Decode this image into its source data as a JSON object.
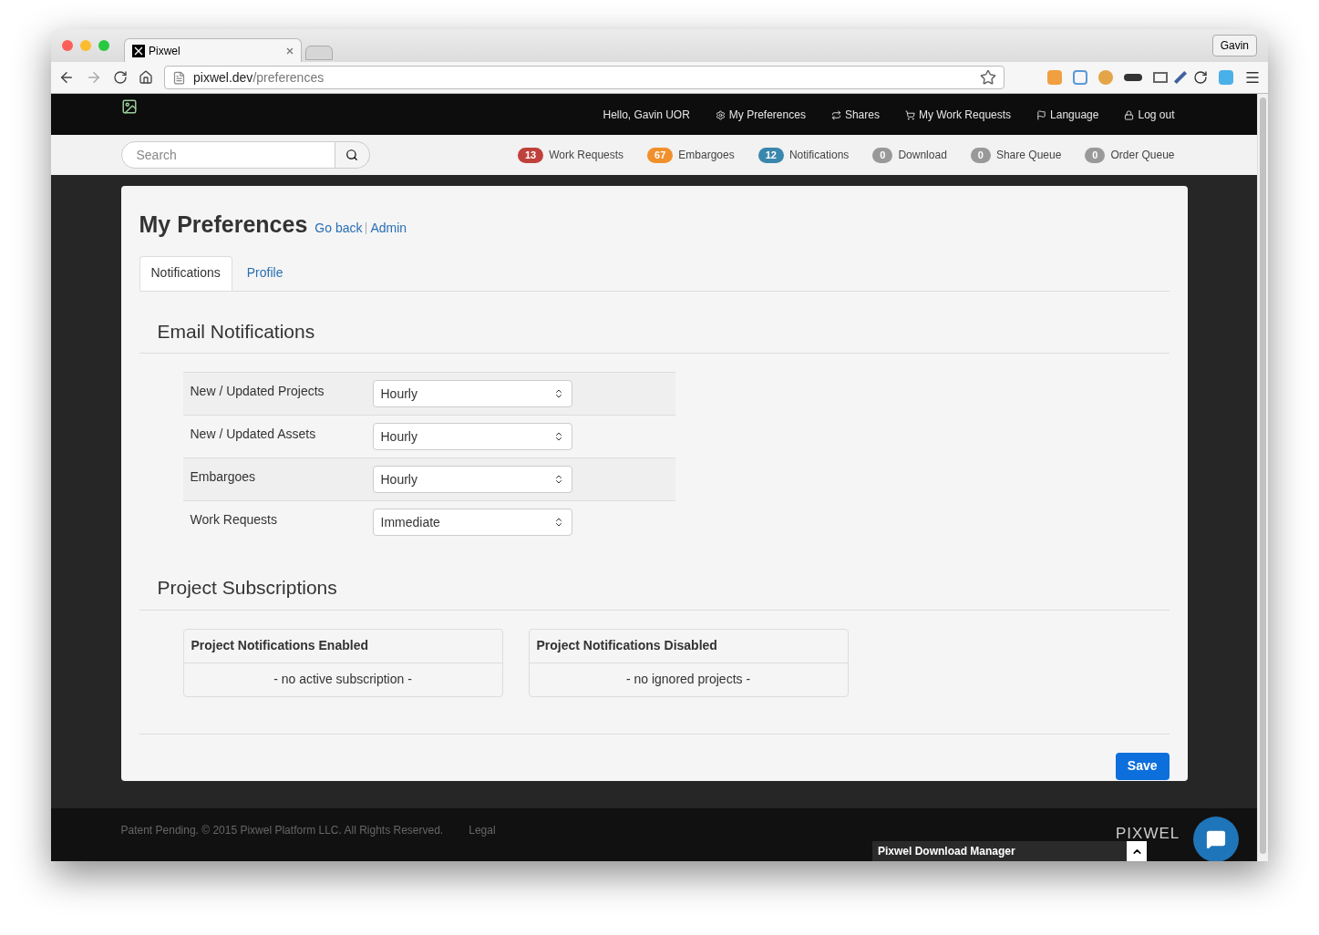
{
  "browser": {
    "tab_title": "Pixwel",
    "profile": "Gavin",
    "url_host": "pixwel.dev",
    "url_path": "/preferences"
  },
  "navbar": {
    "greeting": "Hello, Gavin UOR",
    "links": [
      "My Preferences",
      "Shares",
      "My Work Requests",
      "Language",
      "Log out"
    ]
  },
  "search": {
    "placeholder": "Search"
  },
  "counters": [
    {
      "count": "13",
      "label": "Work Requests",
      "color": "#c0413b"
    },
    {
      "count": "67",
      "label": "Embargoes",
      "color": "#f0902c"
    },
    {
      "count": "12",
      "label": "Notifications",
      "color": "#3a87ad"
    },
    {
      "count": "0",
      "label": "Download",
      "color": "#999999"
    },
    {
      "count": "0",
      "label": "Share Queue",
      "color": "#999999"
    },
    {
      "count": "0",
      "label": "Order Queue",
      "color": "#999999"
    }
  ],
  "page": {
    "title": "My Preferences",
    "links": [
      "Go back",
      "Admin"
    ]
  },
  "tabs": [
    {
      "label": "Notifications",
      "selected": true
    },
    {
      "label": "Profile",
      "selected": false
    }
  ],
  "email_notifications": {
    "title": "Email Notifications",
    "rows": [
      {
        "label": "New / Updated Projects",
        "value": "Hourly"
      },
      {
        "label": "New / Updated Assets",
        "value": "Hourly"
      },
      {
        "label": "Embargoes",
        "value": "Hourly"
      },
      {
        "label": "Work Requests",
        "value": "Immediate"
      }
    ]
  },
  "project_subscriptions": {
    "title": "Project Subscriptions",
    "panels": [
      {
        "title": "Project Notifications Enabled",
        "empty_text": "- no active subscription -"
      },
      {
        "title": "Project Notifications Disabled",
        "empty_text": "- no ignored projects -"
      }
    ]
  },
  "save_button": "Save",
  "footer": {
    "copyright": "Patent Pending. © 2015 Pixwel Platform LLC. All Rights Reserved.",
    "legal": "Legal",
    "logo": "PIXWEL",
    "download_manager": "Pixwel Download Manager"
  }
}
